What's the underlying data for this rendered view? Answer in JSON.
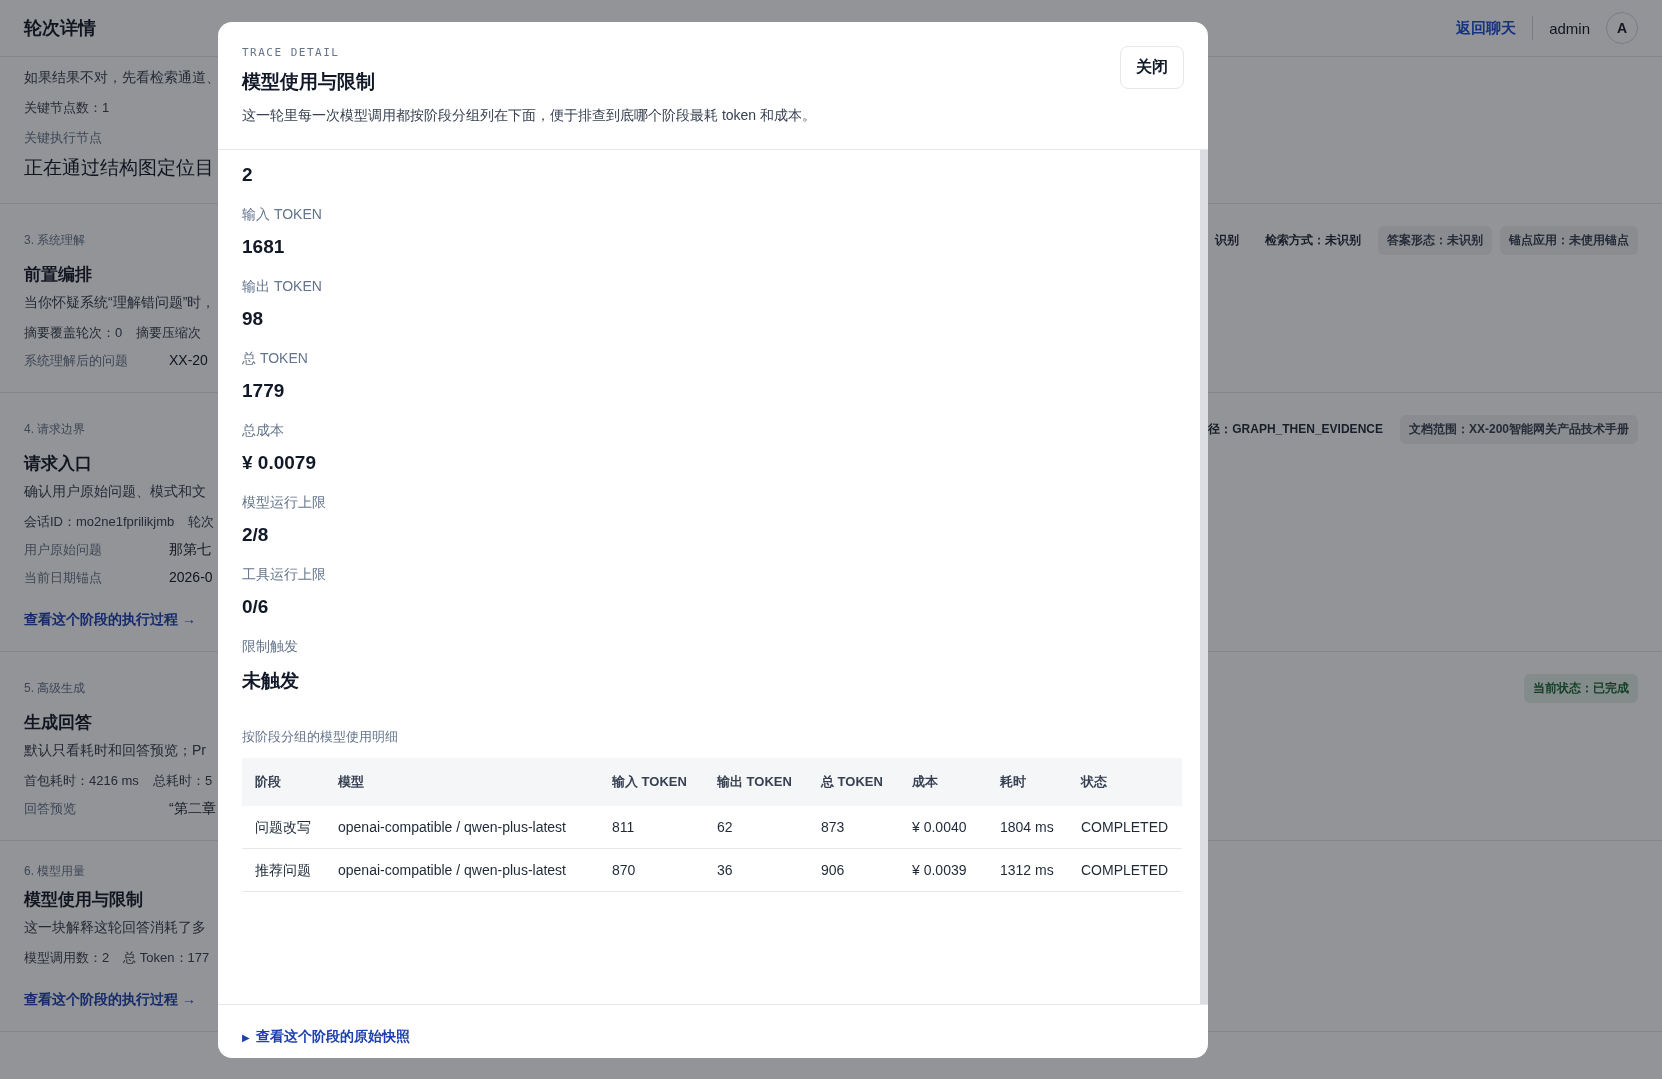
{
  "header": {
    "title": "轮次详情",
    "back_link": "返回聊天",
    "user": {
      "name": "admin",
      "initial": "A"
    }
  },
  "sections": [
    {
      "description": "如果结果不对，先看检索通道、",
      "metrics": [
        "关键节点数：1"
      ],
      "highlight": {
        "label": "关键执行节点",
        "value": "正在通过结构图定位目"
      }
    },
    {
      "step": "3. 系统理解",
      "title": "前置编排",
      "description": "当你怀疑系统“理解错问题”时，",
      "metrics": [
        "摘要覆盖轮次：0",
        "摘要压缩次"
      ],
      "fields": [
        {
          "label": "系统理解后的问题",
          "value": "XX-20"
        }
      ],
      "tags": [
        {
          "text": "识别",
          "kind": "plain"
        },
        {
          "text": "检索方式：未识别",
          "kind": "plain"
        },
        {
          "text": "答案形态：未识别",
          "kind": "chip"
        },
        {
          "text": "锚点应用：未使用锚点",
          "kind": "chip"
        }
      ]
    },
    {
      "step": "4. 请求边界",
      "title": "请求入口",
      "description": "确认用户原始问题、模式和文",
      "metrics": [
        "会话ID：mo2ne1fprilikjmb",
        "轮次"
      ],
      "fields": [
        {
          "label": "用户原始问题",
          "value": "那第七"
        },
        {
          "label": "当前日期锚点",
          "value": "2026-0"
        }
      ],
      "link": "查看这个阶段的执行过程 →",
      "tags": [
        {
          "text": "径：GRAPH_THEN_EVIDENCE",
          "kind": "plain"
        },
        {
          "text": "文档范围：XX-200智能网关产品技术手册",
          "kind": "chip"
        }
      ]
    },
    {
      "step": "5. 高级生成",
      "title": "生成回答",
      "description": "默认只看耗时和回答预览；Pr",
      "metrics": [
        "首包耗时：4216 ms",
        "总耗时：5"
      ],
      "fields": [
        {
          "label": "回答预览",
          "value": "“第二章"
        }
      ],
      "tags": [
        {
          "text": "当前状态：已完成",
          "kind": "success"
        }
      ]
    },
    {
      "step": "6. 模型用量",
      "title": "模型使用与限制",
      "description": "这一块解释这轮回答消耗了多",
      "metrics": [
        "模型调用数：2",
        "总 Token：177"
      ],
      "link": "查看这个阶段的执行过程 →"
    }
  ],
  "modal": {
    "eyebrow": "TRACE DETAIL",
    "title": "模型使用与限制",
    "description": "这一轮里每一次模型调用都按阶段分组列在下面，便于排查到底哪个阶段最耗 token 和成本。",
    "close_label": "关闭",
    "stats": [
      {
        "value": "2"
      },
      {
        "label": "输入 TOKEN",
        "value": "1681"
      },
      {
        "label": "输出 TOKEN",
        "value": "98"
      },
      {
        "label": "总 TOKEN",
        "value": "1779"
      },
      {
        "label": "总成本",
        "value": "¥ 0.0079"
      },
      {
        "label": "模型运行上限",
        "value": "2/8"
      },
      {
        "label": "工具运行上限",
        "value": "0/6"
      },
      {
        "label": "限制触发",
        "value": "未触发"
      }
    ],
    "breakdown": {
      "title": "按阶段分组的模型使用明细",
      "columns": [
        "阶段",
        "模型",
        "输入 TOKEN",
        "输出 TOKEN",
        "总 TOKEN",
        "成本",
        "耗时",
        "状态"
      ],
      "rows": [
        [
          "问题改写",
          "openai-compatible / qwen-plus-latest",
          "811",
          "62",
          "873",
          "¥ 0.0040",
          "1804 ms",
          "COMPLETED"
        ],
        [
          "推荐问题",
          "openai-compatible / qwen-plus-latest",
          "870",
          "36",
          "906",
          "¥ 0.0039",
          "1312 ms",
          "COMPLETED"
        ]
      ]
    },
    "footer_link": {
      "marker": "▶",
      "text": "查看这个阶段的原始快照"
    }
  }
}
